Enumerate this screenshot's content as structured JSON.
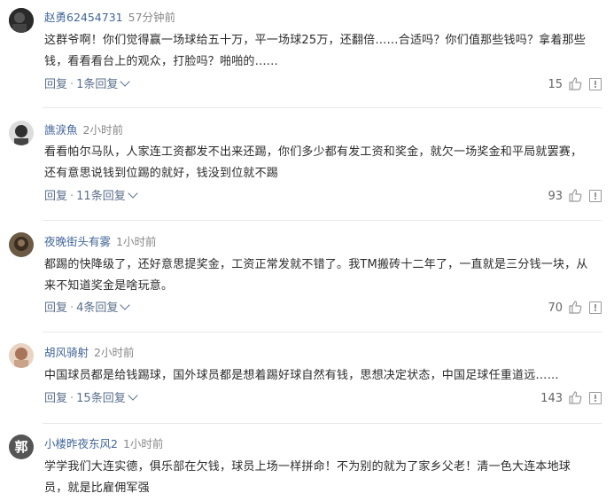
{
  "comments": [
    {
      "username": "赵勇62454731",
      "time": "57分钟前",
      "text": "这群爷啊！你们觉得赢一场球给五十万，平一场球25万，还翻倍……合适吗？你们值那些钱吗？拿着那些钱，看看看台上的观众，打脸吗？啪啪的……",
      "reply_label": "回复",
      "replies_label": "1条回复",
      "likes": "15",
      "avatar_color": "#3a3a3a"
    },
    {
      "username": "譙涙魚",
      "time": "2小时前",
      "text": "看看帕尔马队，人家连工资都发不出来还踢，你们多少都有发工资和奖金，就欠一场奖金和平局就罢赛，还有意思说钱到位踢的就好，钱没到位就不踢",
      "reply_label": "回复",
      "replies_label": "11条回复",
      "likes": "93",
      "avatar_color": "#2f2f2f"
    },
    {
      "username": "夜晚街头有雾",
      "time": "1小时前",
      "text": "都踢的快降级了，还好意思提奖金，工资正常发就不错了。我TM搬砖十二年了，一直就是三分钱一块，从来不知道奖金是啥玩意。",
      "reply_label": "回复",
      "replies_label": "4条回复",
      "likes": "70",
      "avatar_color": "#4a3a2a"
    },
    {
      "username": "胡风骑射",
      "time": "2小时前",
      "text": "中国球员都是给钱踢球，国外球员都是想着踢好球自然有钱，思想决定状态，中国足球任重道远……",
      "reply_label": "回复",
      "replies_label": "15条回复",
      "likes": "143",
      "avatar_color": "#c9a48a"
    },
    {
      "username": "小楼昨夜东风2",
      "time": "1小时前",
      "text": "学学我们大连实德，俱乐部在欠钱，球员上场一样拼命！不为别的就为了家乡父老！清一色大连本地球员，就是比雇佣军强",
      "avatar_glyph": "郭",
      "avatar_color": "#555555"
    }
  ]
}
